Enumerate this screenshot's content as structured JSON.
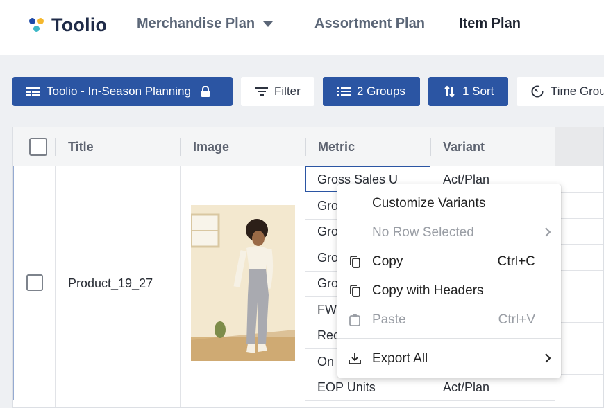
{
  "app": {
    "name": "Toolio"
  },
  "nav": {
    "merchandise_plan": "Merchandise Plan",
    "assortment_plan": "Assortment Plan",
    "item_plan": "Item Plan"
  },
  "toolbar": {
    "view_name": "Toolio - In-Season Planning",
    "filter": "Filter",
    "groups": "2 Groups",
    "sort": "1 Sort",
    "time_group": "Time Grou"
  },
  "grid": {
    "columns": {
      "title": "Title",
      "image": "Image",
      "metric": "Metric",
      "variant": "Variant"
    },
    "row": {
      "title": "Product_19_27",
      "metrics": [
        "Gross Sales U",
        "Gro",
        "Gro",
        "Gro",
        "Gro",
        "FW",
        "Rec",
        "On",
        "EOP Units"
      ],
      "variants": [
        "Act/Plan",
        "Act/Plan"
      ]
    }
  },
  "context_menu": {
    "customize_variants": "Customize Variants",
    "no_row_selected": "No Row Selected",
    "copy": "Copy",
    "copy_shortcut": "Ctrl+C",
    "copy_with_headers": "Copy with Headers",
    "paste": "Paste",
    "paste_shortcut": "Ctrl+V",
    "export_all": "Export All"
  },
  "colors": {
    "primary": "#2b55a3",
    "logo_blue": "#1f4aa8",
    "logo_yellow": "#f5b82e",
    "logo_teal": "#3db8c7"
  }
}
